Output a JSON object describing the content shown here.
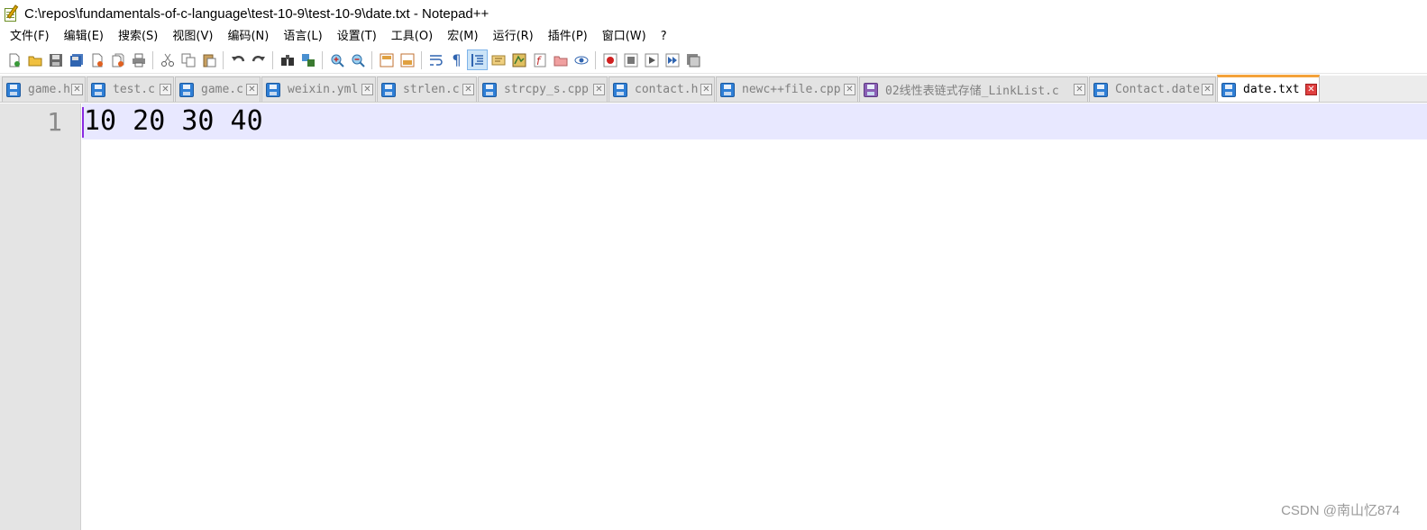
{
  "window": {
    "title": "C:\\repos\\fundamentals-of-c-language\\test-10-9\\test-10-9\\date.txt - Notepad++"
  },
  "menu": [
    "文件(F)",
    "编辑(E)",
    "搜索(S)",
    "视图(V)",
    "编码(N)",
    "语言(L)",
    "设置(T)",
    "工具(O)",
    "宏(M)",
    "运行(R)",
    "插件(P)",
    "窗口(W)",
    "?"
  ],
  "tabs": [
    {
      "label": "game.h",
      "icon": "save-disk-icon",
      "active": false
    },
    {
      "label": "test.c",
      "icon": "save-disk-icon",
      "active": false
    },
    {
      "label": "game.c",
      "icon": "save-disk-icon",
      "active": false
    },
    {
      "label": "weixin.yml",
      "icon": "save-disk-icon",
      "active": false
    },
    {
      "label": "strlen.c",
      "icon": "save-disk-icon",
      "active": false
    },
    {
      "label": "strcpy_s.cpp",
      "icon": "save-disk-icon",
      "active": false
    },
    {
      "label": "contact.h",
      "icon": "save-disk-icon",
      "active": false
    },
    {
      "label": "newc++file.cpp",
      "icon": "save-disk-icon",
      "active": false
    },
    {
      "label": "02线性表链式存储_LinkList.c",
      "icon": "unsaved-disk-icon",
      "active": false
    },
    {
      "label": "Contact.date",
      "icon": "save-disk-icon",
      "active": false
    },
    {
      "label": "date.txt",
      "icon": "save-disk-icon",
      "active": true
    }
  ],
  "editor": {
    "line_numbers": [
      "1"
    ],
    "lines": [
      "10 20 30 40"
    ]
  },
  "watermark": "CSDN @南山忆874",
  "colors": {
    "active_tab_accent": "#f4a23a",
    "current_line_bg": "#e8e8ff",
    "gutter_bg": "#e4e4e4",
    "caret": "#8a2be2"
  }
}
